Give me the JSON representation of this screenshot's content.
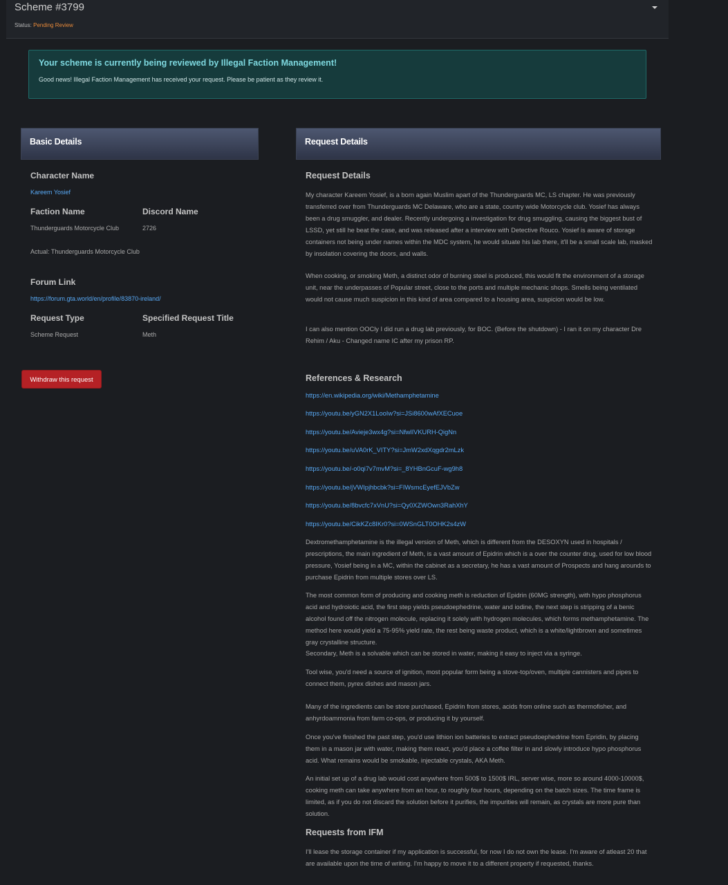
{
  "header": {
    "title": "Scheme #3799",
    "status_label": "Status:",
    "status_value": "Pending Review"
  },
  "alert": {
    "title": "Your scheme is currently being reviewed by Illegal Faction Management!",
    "text": "Good news! Illegal Faction Management has received your request. Please be patient as they review it."
  },
  "basic": {
    "heading": "Basic Details",
    "character_name_label": "Character Name",
    "character_name": "Kareem Yosief",
    "faction_name_label": "Faction Name",
    "faction_name": "Thunderguards Motorcycle Club",
    "faction_actual": "Actual: Thunderguards Motorcycle Club",
    "discord_label": "Discord Name",
    "discord_value": "2726",
    "forum_label": "Forum Link",
    "forum_link": "https://forum.gta.world/en/profile/83870-ireland/",
    "request_type_label": "Request Type",
    "request_type": "Scheme Request",
    "specified_title_label": "Specified Request Title",
    "specified_title": "Meth",
    "withdraw_label": "Withdraw this request"
  },
  "request": {
    "heading": "Request Details",
    "details_title": "Request Details",
    "details_p1": "My character Kareem Yosief, is a born again Muslim apart of the Thunderguards MC, LS chapter. He was previously transferred over from Thunderguards MC Delaware, who are a state, country wide Motorcycle club. Yosief has always been a drug smuggler, and dealer. Recently undergoing a investigation for drug smuggling, causing the biggest bust of LSSD, yet still he beat the case, and was released after a interview with Detective Rouco. Yosief is aware of storage containers not being under names within the MDC system, he would situate his lab there, it'll be a small scale lab, masked by insolation covering the doors, and walls.",
    "details_p2": "When cooking, or smoking Meth, a distinct odor of burning steel is produced, this would fit the environment of a storage unit, near the underpasses of Popular street, close to the ports and multiple mechanic shops. Smells being ventilated would not cause much suspicion in this kind of area compared to a housing area, suspicion would be low.",
    "details_p3": "I can also mention OOCly I did run a drug lab previously, for BOC. (Before the shutdown) - I ran it on my character Dre Rehim / Aku - Changed name IC after my prison RP.",
    "refs_title": "References & Research",
    "refs": [
      "https://en.wikipedia.org/wiki/Methamphetamine",
      "https://youtu.be/yGN2X1LooIw?si=JSi8600wAfXECuoe",
      "https://youtu.be/Avieje3wx4g?si=NfwlIVKURH-QigNn",
      "https://youtu.be/uVA0rK_VITY?si=JmW2xdXqgdr2mLzk",
      "https://youtu.be/-o0qi7v7mvM?si=_8YHBnGcuF-wg9h8",
      "https://youtu.be/jVWIpjhbcbk?si=FIWsmcEyefEJVbZw",
      "https://youtu.be/8bvcfc7xVnU?si=Qy0XZWOwn3RahXhY",
      "https://youtu.be/CikKZc8IKr0?si=0WSnGLT0OHK2s4zW"
    ],
    "refs_p1": "Dextromethamphetamine is the illegal version of Meth, which is different from the DESOXYN used in hospitals / prescriptions, the main ingredient of Meth, is a vast amount of Epidrin which is a over the counter drug, used for low blood pressure, Yosief being in a MC, within the cabinet as a secretary, he has a vast amount of Prospects and hang arounds to purchase Epidrin from multiple stores over LS.",
    "refs_p2": "The most common form of producing and cooking meth is reduction of Epidrin (60MG strength), with hypo phosphorus acid and hydroiotic acid, the first step yields pseudoephedrine, water and iodine, the next step is stripping of a benic alcohol found off the nitrogen molecule, replacing it solely with hydrogen molecules, which forms methamphetamine. The method here would yield a 75-95% yield rate, the rest being waste product, which is a white/lightbrown and sometimes gray crystalline structure.",
    "refs_p2b": "Secondary, Meth is a solvable which can be stored in water, making it easy to inject via a syringe.",
    "refs_p3": "Tool wise, you'd need a source of ignition, most popular form being a stove-top/oven, multiple cannisters and pipes to connect them, pyrex dishes and mason jars.",
    "refs_p4": "Many of the ingredients can be store purchased, Epidrin from stores, acids from online such as thermofisher, and anhyrdoammonia from farm co-ops, or producing it by yourself.",
    "refs_p5": "Once you've finished the past step, you'd use lithion ion batteries to extract pseudoephedrine from Epridin, by placing them in a mason jar with water, making them react, you'd place a coffee filter in and slowly introduce hypo phosphorus acid. What remains would be smokable, injectable crystals, AKA Meth.",
    "refs_p6": "An initial set up of a drug lab would cost anywhere from 500$ to 1500$ IRL, server wise, more so around 4000-10000$, cooking meth can take anywhere from an hour, to roughly four hours, depending on the batch sizes. The time frame is limited, as if you do not discard the solution before it purifies, the impurities will remain, as crystals are more pure than solution.",
    "ifm_title": "Requests from IFM",
    "ifm_p": "I'll lease the storage container if my application is successful, for now I do not own the lease. I'm aware of atleast 20 that are available upon the time of writing. I'm happy to move it to a different property if requested, thanks."
  }
}
